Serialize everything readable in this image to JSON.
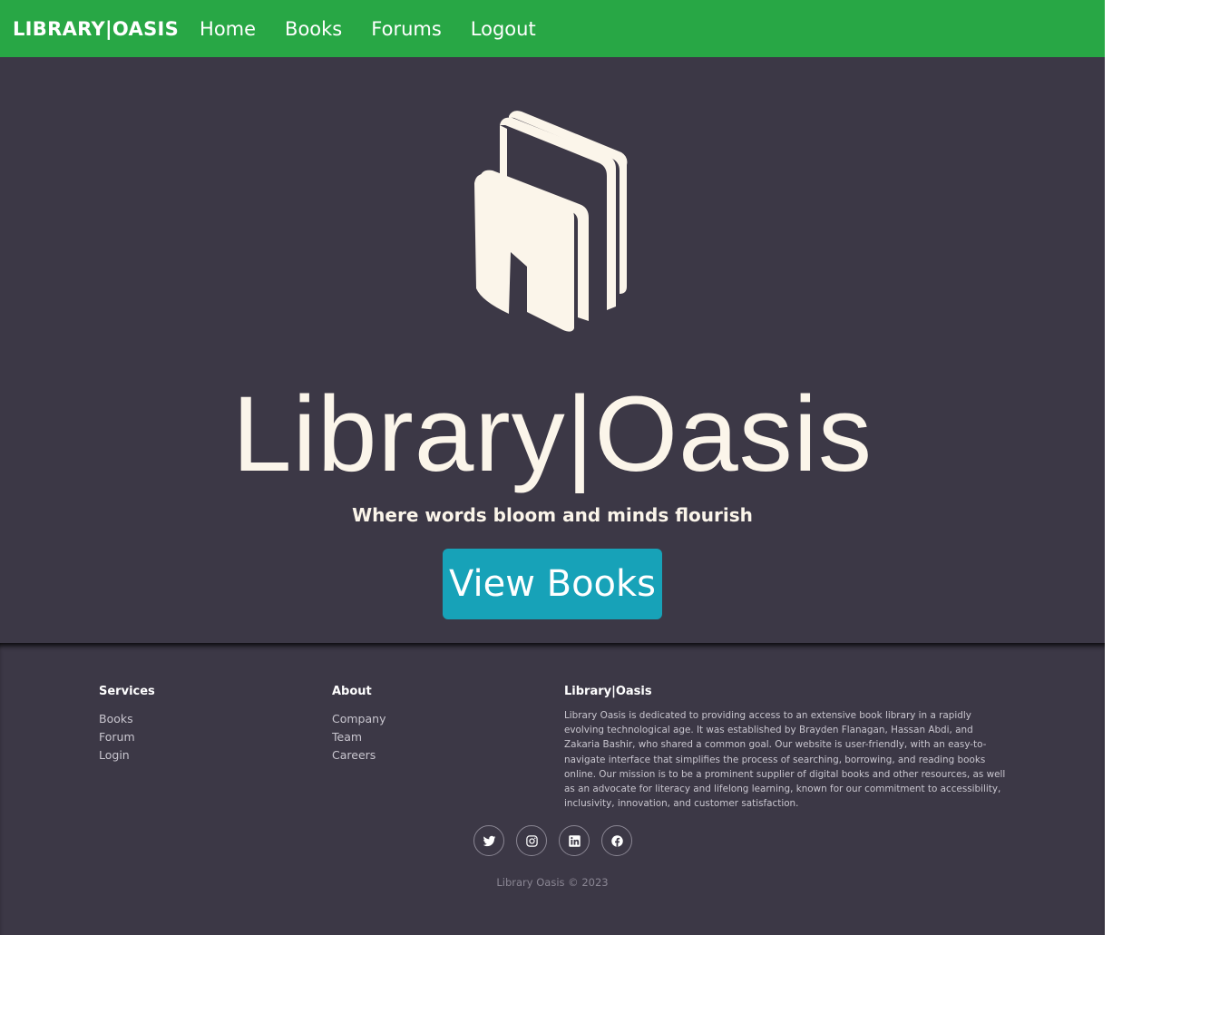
{
  "navbar": {
    "brand": "LIBRARY|OASIS",
    "links": [
      "Home",
      "Books",
      "Forums",
      "Logout"
    ]
  },
  "hero": {
    "logo_icon": "books-icon",
    "title": "Library|Oasis",
    "tagline": "Where words bloom and minds flourish",
    "button_label": "View Books"
  },
  "footer": {
    "services": {
      "heading": "Services",
      "links": [
        "Books",
        "Forum",
        "Login"
      ]
    },
    "about": {
      "heading": "About",
      "links": [
        "Company",
        "Team",
        "Careers"
      ]
    },
    "brand": {
      "heading": "Library|Oasis",
      "text": "Library Oasis is dedicated to providing access to an extensive book library in a rapidly evolving technological age. It was established by Brayden Flanagan, Hassan Abdi, and Zakaria Bashir, who shared a common goal. Our website is user-friendly, with an easy-to-navigate interface that simplifies the process of searching, borrowing, and reading books online. Our mission is to be a prominent supplier of digital books and other resources, as well as an advocate for literacy and lifelong learning, known for our commitment to accessibility, inclusivity, innovation, and customer satisfaction."
    },
    "social_icons": [
      "twitter-icon",
      "instagram-icon",
      "linkedin-icon",
      "facebook-icon"
    ],
    "copyright": "Library Oasis © 2023"
  },
  "colors": {
    "nav_bg": "#28a745",
    "page_bg": "#3c3846",
    "cream": "#fbf5ea",
    "button_bg": "#17a2b8"
  }
}
